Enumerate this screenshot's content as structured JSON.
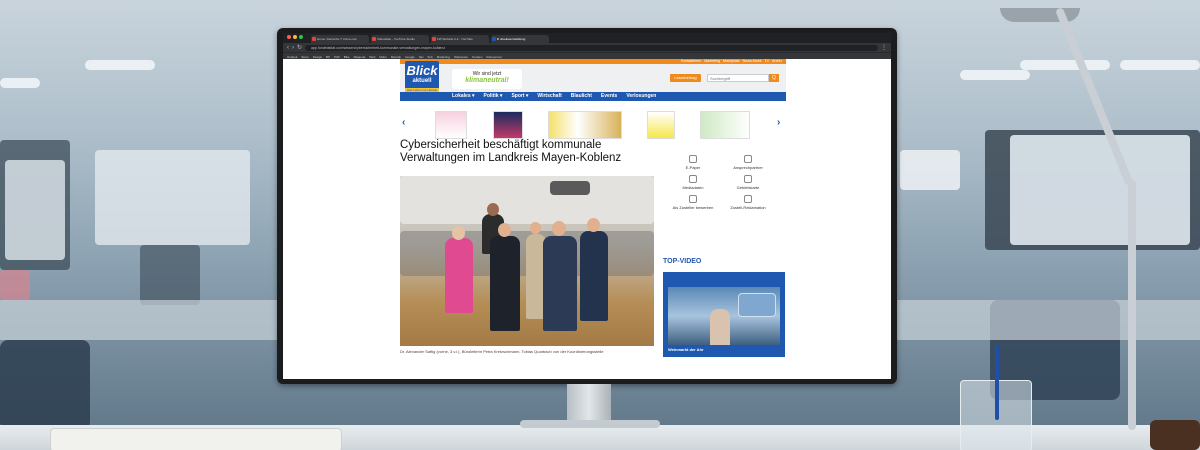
{
  "browser": {
    "tabs": [
      "Home: Deutsche T. Flime.com",
      "Videodatei - YouTube Studio",
      "FW Website 0-2 - YouTube",
      "B urlaubsentwicklung"
    ],
    "url": "app.fondetablat.com/wissen/cybersicherheit-kommunale-verwaltungen-mayen-koblenz",
    "bookmarks": [
      "Outlook",
      "Sicce",
      "Design",
      "BP",
      "PtW",
      "Bike",
      "Magenta",
      "Web",
      "Mobs",
      "Ricardo",
      "Google",
      "Net",
      "Sub",
      "Marketing",
      "Webseiten",
      "Kunden",
      "Referenzen"
    ]
  },
  "site": {
    "topbar_links": [
      "Kontaktieren",
      "Marketing",
      "Marktplatz",
      "News-Mobil",
      "TV",
      "Archiv"
    ],
    "logo": {
      "line1": "Blick",
      "line2": "aktuell",
      "tagline": "Das Leben zur Heimat"
    },
    "banner": {
      "line1": "Wir sind jetzt",
      "line2": "klimaneutral!"
    },
    "login_button": "Leserbeitrag",
    "search_placeholder": "Suchbegriff",
    "search_button": "Q",
    "nav": [
      "Lokales ▾",
      "Politik ▾",
      "Sport ▾",
      "Wirtschaft",
      "Blaulicht",
      "Events",
      "Verlosungen"
    ],
    "headline": "Cybersicherheit beschäftigt kommunale Verwaltungen im Landkreis Mayen-Koblenz",
    "caption": "Dr. Alexander Saftig (vorne, 3.v.l.), Büroleiterin Petra Kretzschmann, Tobias Quarbach von der Koordinierungsstelle",
    "sidebar_items": [
      "E-Paper",
      "Ansprechpartner",
      "Mediadaten",
      "Gebietskarte",
      "Als Zusteller bewerben",
      "Zustell-Reklamation"
    ],
    "top_video": {
      "title": "TOP-VIDEO",
      "caption": "Weinmarkt der Ahr"
    }
  },
  "colors": {
    "brand_blue": "#1f58b0",
    "brand_orange": "#f08a1c",
    "brand_green": "#8cc63f"
  }
}
